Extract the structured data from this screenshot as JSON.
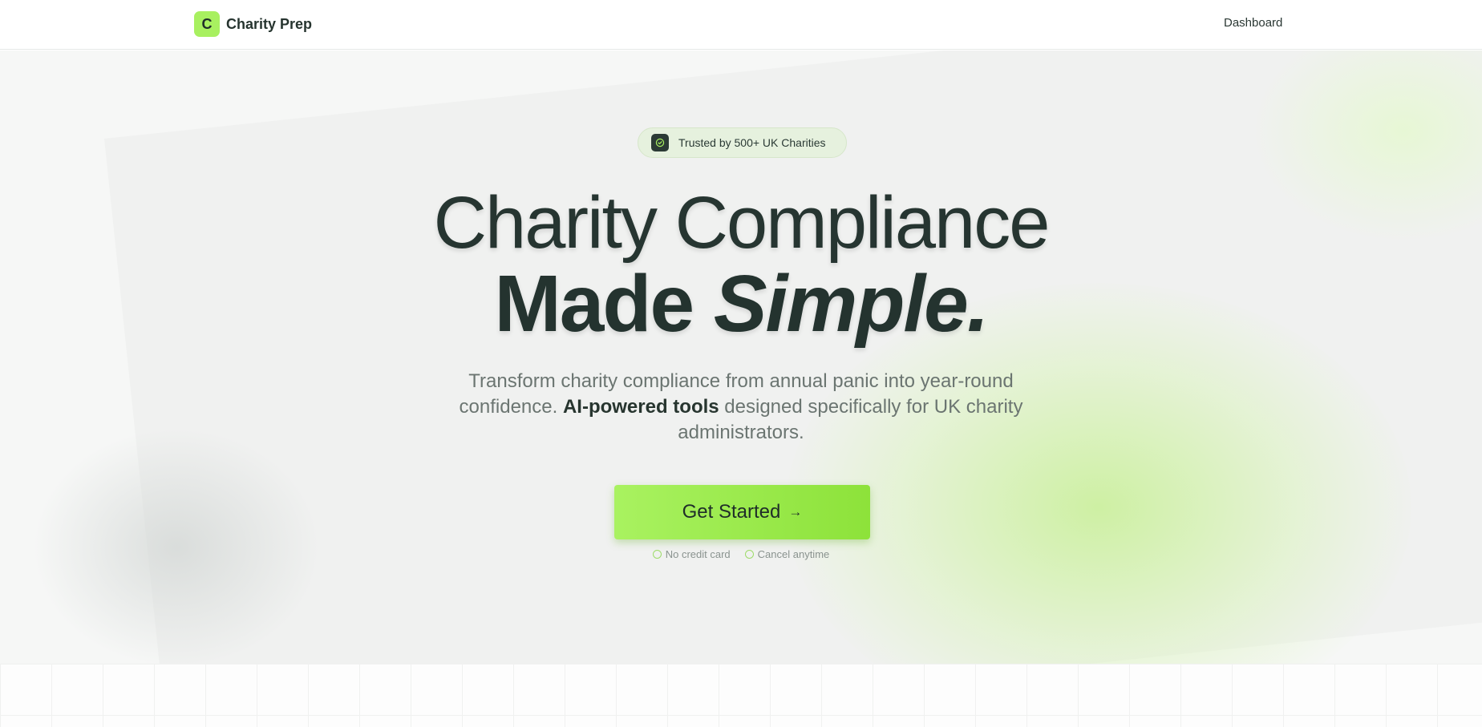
{
  "header": {
    "brand_initial": "C",
    "brand_name": "Charity Prep",
    "nav_dashboard": "Dashboard"
  },
  "hero": {
    "trust_badge": "Trusted by 500+ UK Charities",
    "headline_line1": "Charity Compliance",
    "headline_line2_regular": "Made ",
    "headline_line2_emphasis": "Simple.",
    "subtitle_part1": "Transform charity compliance from annual panic into year-round confidence. ",
    "subtitle_bold": "AI-powered tools",
    "subtitle_part2": " designed specifically for UK charity administrators.",
    "cta_label": "Get Started",
    "cta_arrow": "→",
    "assurances": [
      "No credit card",
      "Cancel anytime"
    ]
  },
  "colors": {
    "accent_green": "#a8f060",
    "dark_text": "#24332f",
    "muted_text": "#6b7571"
  },
  "icons": {
    "trust_badge": "check-circle-icon",
    "cta": "arrow-right-icon",
    "assurance": "circle-check-icon"
  }
}
